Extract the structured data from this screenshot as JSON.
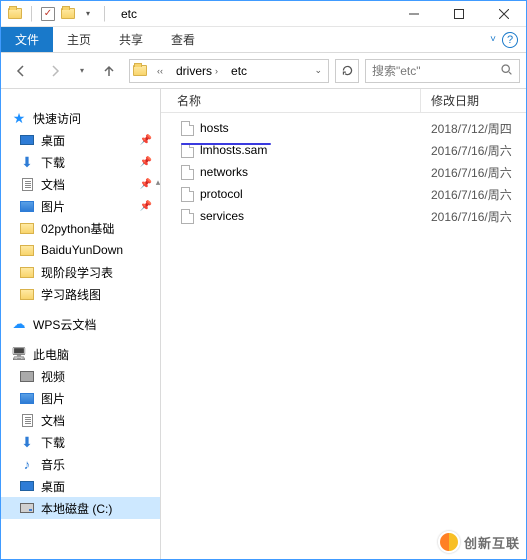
{
  "window": {
    "title": "etc"
  },
  "ribbon": {
    "file": "文件",
    "home": "主页",
    "share": "共享",
    "view": "查看"
  },
  "address": {
    "seg1": "drivers",
    "seg2": "etc"
  },
  "search": {
    "placeholder": "搜索\"etc\""
  },
  "columns": {
    "name": "名称",
    "date": "修改日期"
  },
  "files": [
    {
      "name": "hosts",
      "date": "2018/7/12/周四"
    },
    {
      "name": "lmhosts.sam",
      "date": "2016/7/16/周六"
    },
    {
      "name": "networks",
      "date": "2016/7/16/周六"
    },
    {
      "name": "protocol",
      "date": "2016/7/16/周六"
    },
    {
      "name": "services",
      "date": "2016/7/16/周六"
    }
  ],
  "sidebar": {
    "quick": "快速访问",
    "desktop": "桌面",
    "downloads": "下载",
    "documents": "文档",
    "pictures": "图片",
    "f1": "02python基础",
    "f2": "BaiduYunDown",
    "f3": "现阶段学习表",
    "f4": "学习路线图",
    "wps": "WPS云文档",
    "pc": "此电脑",
    "video": "视频",
    "pic2": "图片",
    "doc2": "文档",
    "dl2": "下载",
    "music": "音乐",
    "desk2": "桌面",
    "drive": "本地磁盘 (C:)"
  },
  "watermark": "创新互联"
}
